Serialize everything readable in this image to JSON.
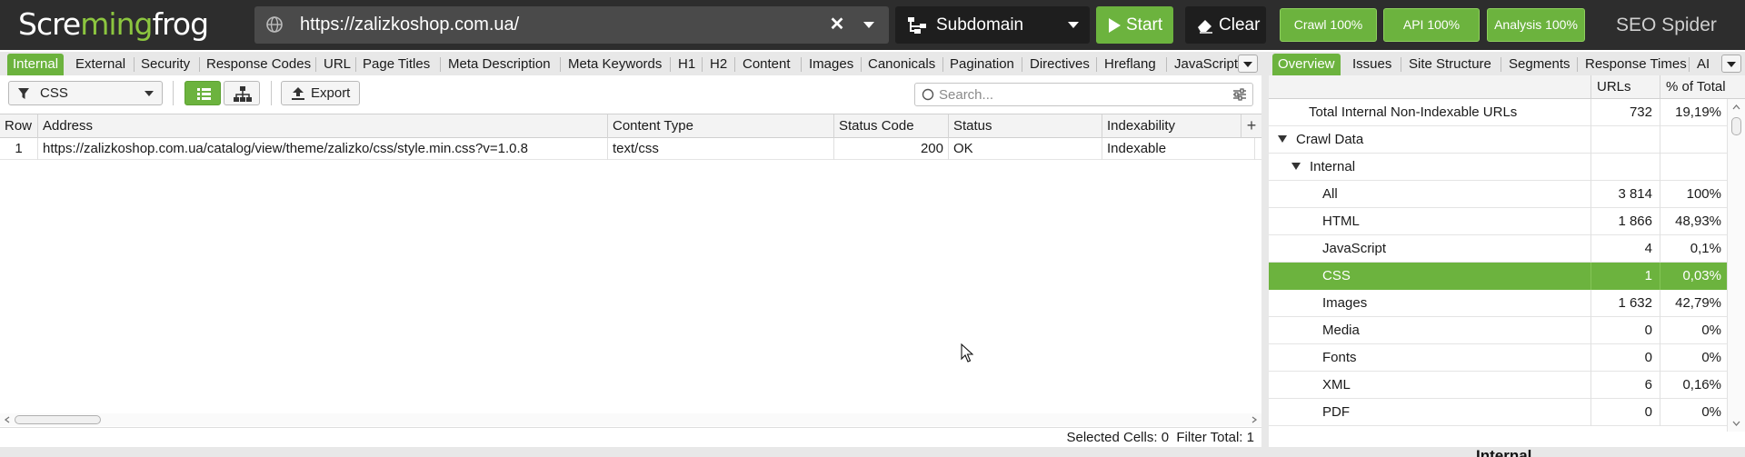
{
  "app": {
    "logo_left": "Scre",
    "logo_mid": "ming",
    "logo_right": "frog",
    "product": "SEO Spider"
  },
  "topbar": {
    "url": "https://zalizkoshop.com.ua/",
    "mode": "Subdomain",
    "start_label": "Start",
    "clear_label": "Clear",
    "crawl_progress": "Crawl 100%",
    "api_progress": "API 100%",
    "analysis_progress": "Analysis 100%",
    "accent": "#6cb33e"
  },
  "left_tabs": [
    "Internal",
    "External",
    "Security",
    "Response Codes",
    "URL",
    "Page Titles",
    "Meta Description",
    "Meta Keywords",
    "H1",
    "H2",
    "Content",
    "Images",
    "Canonicals",
    "Pagination",
    "Directives",
    "Hreflang",
    "JavaScript"
  ],
  "right_tabs": [
    "Overview",
    "Issues",
    "Site Structure",
    "Segments",
    "Response Times",
    "AI"
  ],
  "toolbar": {
    "filter": "CSS",
    "export_label": "Export",
    "search_placeholder": "Search..."
  },
  "grid": {
    "columns": [
      "Row",
      "Address",
      "Content Type",
      "Status Code",
      "Status",
      "Indexability"
    ],
    "rows": [
      {
        "row": "1",
        "address": "https://zalizkoshop.com.ua/catalog/view/theme/zalizko/css/style.min.css?v=1.0.8",
        "content_type": "text/css",
        "status_code": "200",
        "status": "OK",
        "indexability": "Indexable"
      }
    ]
  },
  "statusbar": {
    "selected_label": "Selected Cells:",
    "selected_value": "0",
    "filter_label": "Filter Total:",
    "filter_value": "1"
  },
  "overview": {
    "col_urls": "URLs",
    "col_pct": "% of Total",
    "rows": [
      {
        "label": "Total Internal Non-Indexable URLs",
        "urls": "732",
        "pct": "19,19%"
      },
      {
        "label": "Crawl Data",
        "urls": "",
        "pct": ""
      },
      {
        "label": "Internal",
        "urls": "",
        "pct": ""
      },
      {
        "label": "All",
        "urls": "3 814",
        "pct": "100%"
      },
      {
        "label": "HTML",
        "urls": "1 866",
        "pct": "48,93%"
      },
      {
        "label": "JavaScript",
        "urls": "4",
        "pct": "0,1%"
      },
      {
        "label": "CSS",
        "urls": "1",
        "pct": "0,03%"
      },
      {
        "label": "Images",
        "urls": "1 632",
        "pct": "42,79%"
      },
      {
        "label": "Media",
        "urls": "0",
        "pct": "0%"
      },
      {
        "label": "Fonts",
        "urls": "0",
        "pct": "0%"
      },
      {
        "label": "XML",
        "urls": "6",
        "pct": "0,16%"
      },
      {
        "label": "PDF",
        "urls": "0",
        "pct": "0%"
      }
    ],
    "chart_title": "Internal"
  }
}
